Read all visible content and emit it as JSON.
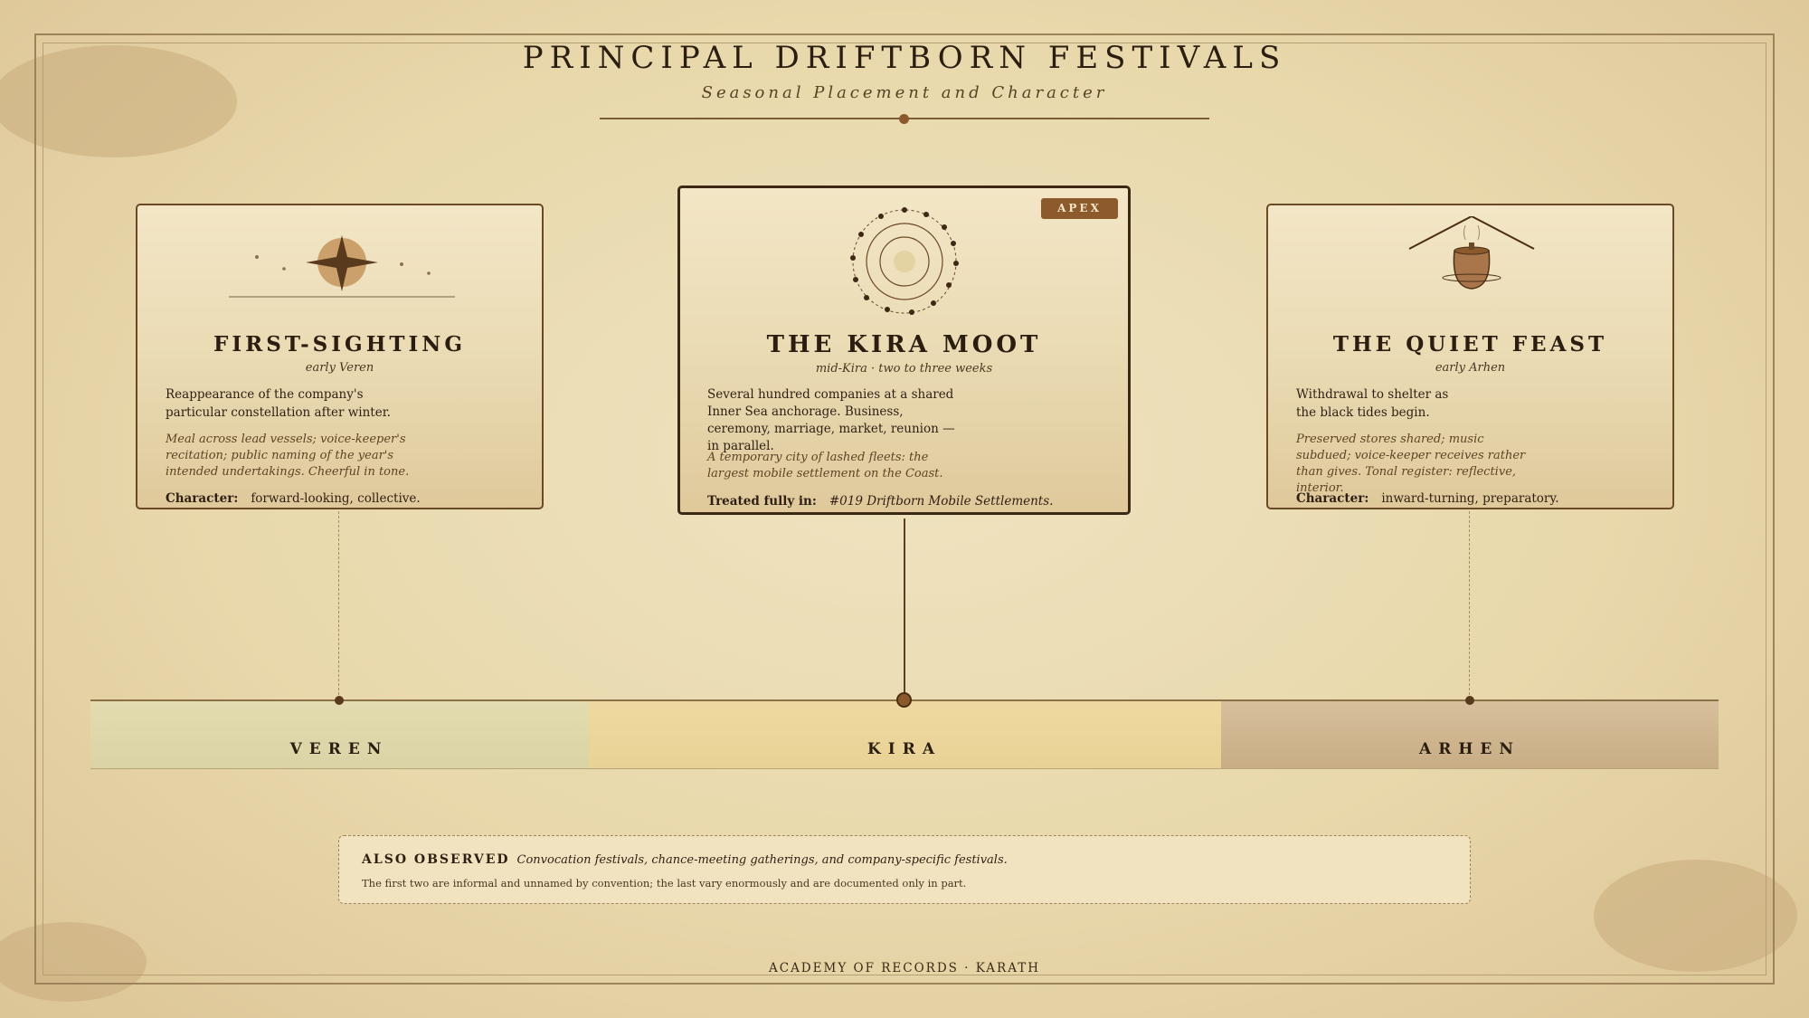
{
  "header": {
    "title": "PRINCIPAL DRIFTBORN FESTIVALS",
    "subtitle": "Seasonal Placement and Character"
  },
  "festivals": [
    {
      "name": "FIRST-SIGHTING",
      "when": "early Veren",
      "description": "Reappearance of the company's particular constellation after winter.",
      "note": "Meal across lead vessels; voice-keeper's recitation; public naming of the year's intended undertakings. Cheerful in tone.",
      "character_label": "Character:",
      "character": "forward-looking, collective.",
      "icon": "four-point-star-icon"
    },
    {
      "name": "THE KIRA MOOT",
      "when": "mid-Kira · two to three weeks",
      "badge": "APEX",
      "description": "Several hundred companies at a shared Inner Sea anchorage. Business, ceremony, marriage, market, reunion — in parallel.",
      "note": "A temporary city of lashed fleets: the largest mobile settlement on the Coast.",
      "treated_label": "Treated fully in:",
      "treated": "#019 Driftborn Mobile Settlements.",
      "icon": "ring-of-ships-icon"
    },
    {
      "name": "THE QUIET FEAST",
      "when": "early Arhen",
      "description": "Withdrawal to shelter as the black tides begin.",
      "note": "Preserved stores shared; music subdued; voice-keeper receives rather than gives. Tonal register: reflective, interior.",
      "character_label": "Character:",
      "character": "inward-turning, preparatory.",
      "icon": "covered-pot-icon"
    }
  ],
  "seasons": [
    "VEREN",
    "KIRA",
    "ARHEN"
  ],
  "also_observed": {
    "label": "ALSO OBSERVED",
    "text": "Convocation festivals, chance-meeting gatherings, and company-specific festivals.",
    "sub": "The first two are informal and unnamed by convention; the last vary enormously and are documented only in part."
  },
  "footer": "ACADEMY OF RECORDS · KARATH",
  "colors": {
    "accent": "#8c5a2b",
    "ink": "#2b1d10",
    "veren_band": "#dcd6aa",
    "kira_band": "#ecd59b",
    "arhen_band": "#cfb791"
  }
}
